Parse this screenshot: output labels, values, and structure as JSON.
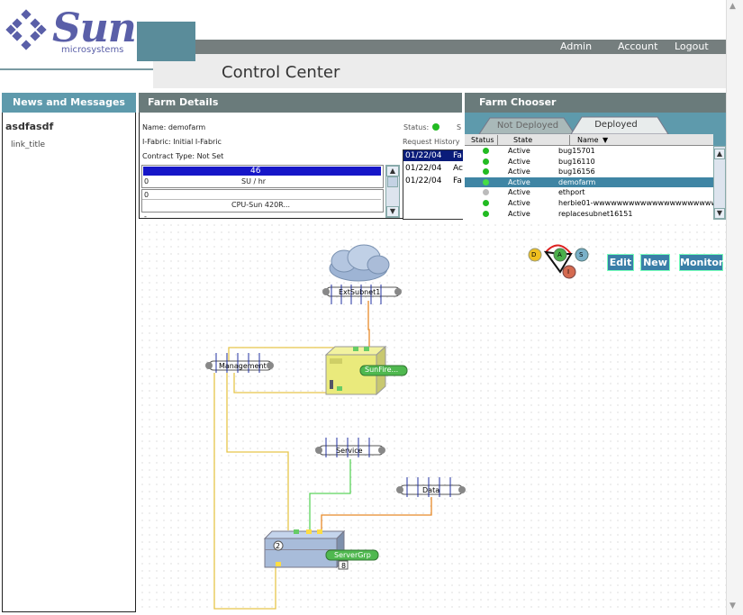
{
  "logo": {
    "word": "Sun",
    "sub": "microsystems"
  },
  "header": {
    "title": "Control Center",
    "links": [
      "Admin",
      "Account",
      "Logout"
    ]
  },
  "news": {
    "heading": "News and Messages",
    "title": "asdfasdf",
    "link": "link_title"
  },
  "farm_details": {
    "heading": "Farm Details",
    "name_label": "Name: demofarm",
    "ifabric_label": "I-Fabric: Initial I-Fabric",
    "contract_label": "Contract Type: Not Set",
    "status_label": "Status:",
    "status_extra": "S",
    "request_history_label": "Request History",
    "su_value": "46",
    "su_min": "0",
    "su_unit": "SU / hr",
    "su_fill": 1.0,
    "cpu_value": "0",
    "cpu_name": "CPU-Sun 420R...",
    "history": [
      {
        "date": "01/22/04",
        "status": "Fa"
      },
      {
        "date": "01/22/04",
        "status": "Ac"
      },
      {
        "date": "01/22/04",
        "status": "Fa"
      }
    ]
  },
  "farm_chooser": {
    "heading": "Farm Chooser",
    "tabs": [
      "Not Deployed",
      "Deployed"
    ],
    "columns": [
      "Status",
      "State",
      "Name"
    ],
    "sort_indicator": "▼",
    "rows": [
      {
        "state": "Active",
        "name": "bug15701",
        "dot": "#22bb22"
      },
      {
        "state": "Active",
        "name": "bug16110",
        "dot": "#22bb22"
      },
      {
        "state": "Active",
        "name": "bug16156",
        "dot": "#22bb22"
      },
      {
        "state": "Active",
        "name": "demofarm",
        "dot": "#44dd44"
      },
      {
        "state": "Active",
        "name": "ethport",
        "dot": "#bbbbbb"
      },
      {
        "state": "Active",
        "name": "herbie01-wwwwwwwwwwwwwwwwwwwwww",
        "dot": "#22bb22"
      },
      {
        "state": "Active",
        "name": "replacesubnet16151",
        "dot": "#22bb22"
      }
    ]
  },
  "toolbar": {
    "edit": "Edit",
    "new": "New",
    "monitor": "Monitor"
  },
  "dasi": {
    "d": "D",
    "a": "A",
    "s": "S",
    "i": "I"
  },
  "topology": {
    "ext_subnet": "ExtSubnet1",
    "management": "Management",
    "service": "Service",
    "data": "Data",
    "server1": "SunFire...",
    "server_group": "ServerGrp",
    "group_count": "2",
    "group_badge": "8"
  },
  "colors": {
    "teal": "#5e9aac",
    "grey_header": "#6a7b7b",
    "orange_wire": "#e88a2a",
    "yellow_wire": "#e6c54a",
    "green_wire": "#5cd45c"
  }
}
